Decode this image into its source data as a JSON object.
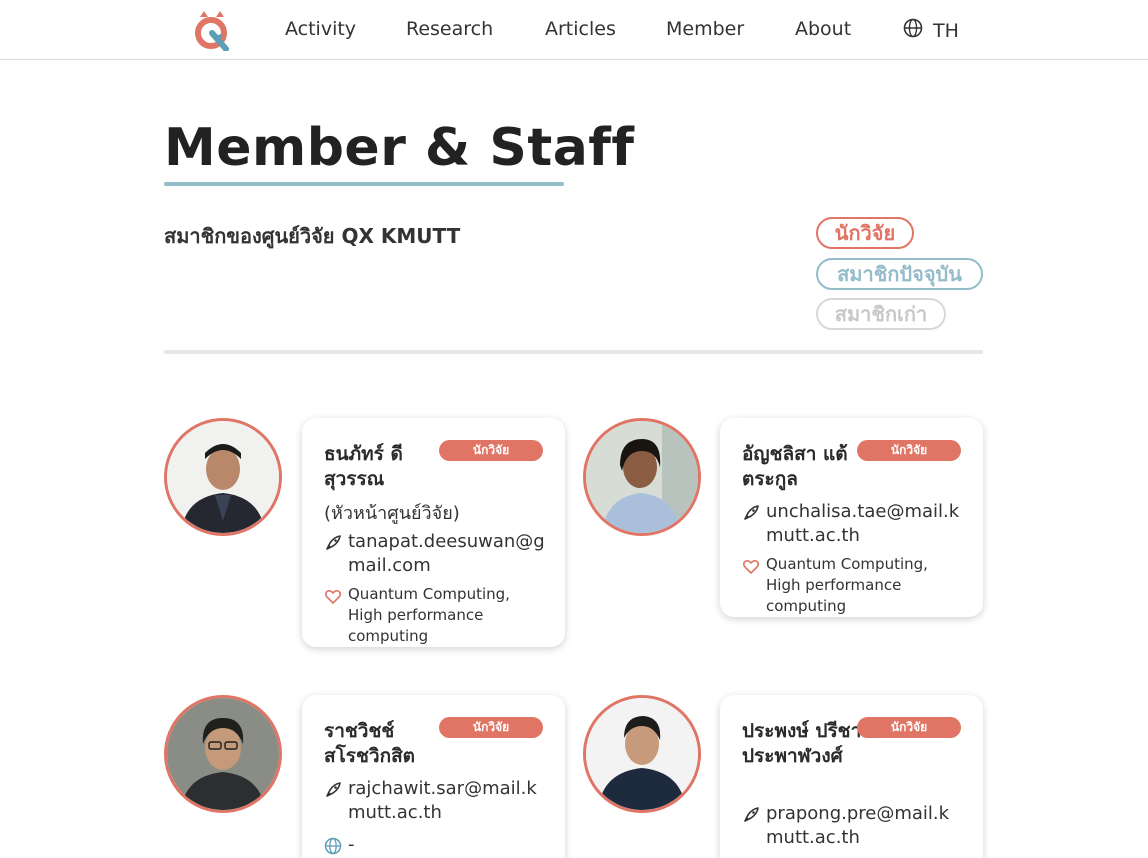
{
  "nav": {
    "items": [
      "Activity",
      "Research",
      "Articles",
      "Member",
      "About"
    ],
    "language": "TH"
  },
  "page": {
    "title": "Member & Staff",
    "subtitle": "สมาชิกของศูนย์วิจัย QX KMUTT"
  },
  "filters": {
    "researcher": "นักวิจัย",
    "current": "สมาชิกปัจจุบัน",
    "alumni": "สมาชิกเก่า"
  },
  "members": [
    {
      "name": "ธนภัทร์ ดีสุวรรณ",
      "extra": "(หัวหน้าศูนย์วิจัย)",
      "role": "นักวิจัย",
      "email": "tanapat.deesuwan@gmail.com",
      "interest": "Quantum Computing, High performance computing"
    },
    {
      "name": "อัญชลิสา แต้ตระกูล",
      "role": "นักวิจัย",
      "email": "unchalisa.tae@mail.kmutt.ac.th",
      "interest": "Quantum Computing, High performance computing"
    },
    {
      "name": "ราชวิชช์ สโรชวิกสิต",
      "role": "นักวิจัย",
      "email": "rajchawit.sar@mail.kmutt.ac.th",
      "website": "-"
    },
    {
      "name": "ประพงษ์ ปรีชาประพาฬวงศ์",
      "role": "นักวิจัย",
      "email": "prapong.pre@mail.kmutt.ac.th"
    }
  ],
  "colors": {
    "accent": "#e07565",
    "secondary": "#94bccb",
    "muted": "#c8c8c8"
  }
}
